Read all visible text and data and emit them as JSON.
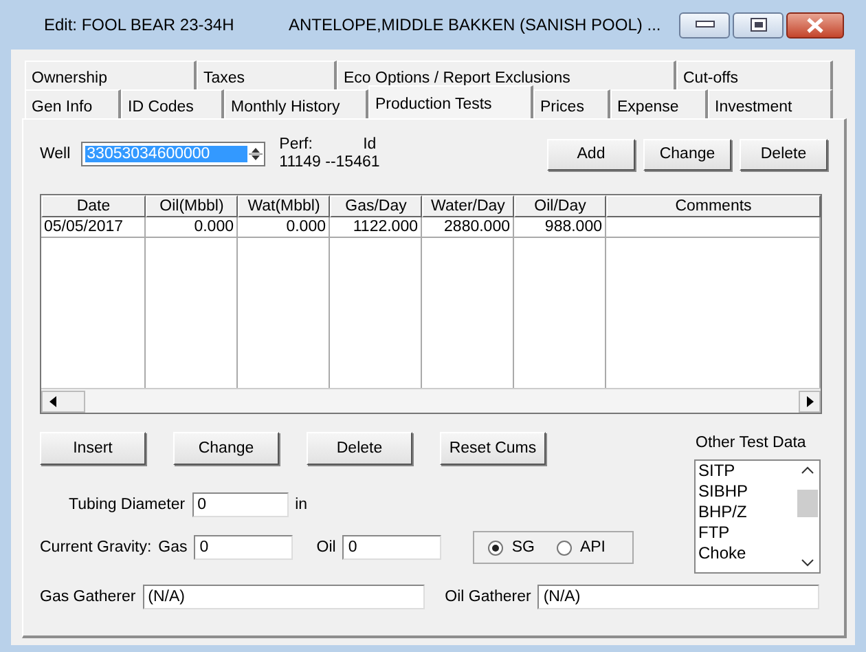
{
  "window": {
    "title": "Edit: FOOL BEAR 23-34H",
    "subtitle": "ANTELOPE,MIDDLE BAKKEN (SANISH POOL) ..."
  },
  "tab_rows": [
    [
      {
        "label": "Ownership",
        "selected": false
      },
      {
        "label": "Taxes",
        "selected": false
      },
      {
        "label": "Eco Options / Report Exclusions",
        "selected": false
      },
      {
        "label": "Cut-offs",
        "selected": false
      }
    ],
    [
      {
        "label": "Gen Info",
        "selected": false
      },
      {
        "label": "ID Codes",
        "selected": false
      },
      {
        "label": "Monthly History",
        "selected": false
      },
      {
        "label": "Production Tests",
        "selected": true
      },
      {
        "label": "Prices",
        "selected": false
      },
      {
        "label": "Expense",
        "selected": false
      },
      {
        "label": "Investment",
        "selected": false
      }
    ]
  ],
  "well": {
    "label": "Well",
    "value": "33053034600000",
    "highlighted": true,
    "perf_label": "Perf:",
    "id_label": "Id",
    "perf_range": "11149 --15461"
  },
  "top_buttons": [
    "Add",
    "Change",
    "Delete"
  ],
  "table": {
    "columns": [
      "Date",
      "Oil(Mbbl)",
      "Wat(Mbbl)",
      "Gas/Day",
      "Water/Day",
      "Oil/Day",
      "Comments"
    ],
    "rows": [
      [
        "05/05/2017",
        "0.000",
        "0.000",
        "1122.000",
        "2880.000",
        "988.000"
      ]
    ]
  },
  "action_buttons": [
    "Insert",
    "Change",
    "Delete",
    "Reset Cums"
  ],
  "tubing": {
    "label": "Tubing Diameter",
    "value": "0",
    "unit": "in"
  },
  "gravity": {
    "label": "Current Gravity:",
    "gas_label": "Gas",
    "gas_value": "0",
    "oil_label": "Oil",
    "oil_value": "0",
    "options": [
      {
        "label": "SG",
        "selected": true
      },
      {
        "label": "API",
        "selected": false
      }
    ]
  },
  "other_test_data": {
    "label": "Other Test Data",
    "items": [
      "SITP",
      "SIBHP",
      "BHP/Z",
      "FTP",
      "Choke"
    ]
  },
  "gatherers": [
    {
      "label": "Gas Gatherer",
      "value": "(N/A)"
    },
    {
      "label": "Oil Gatherer",
      "value": "(N/A)"
    }
  ]
}
